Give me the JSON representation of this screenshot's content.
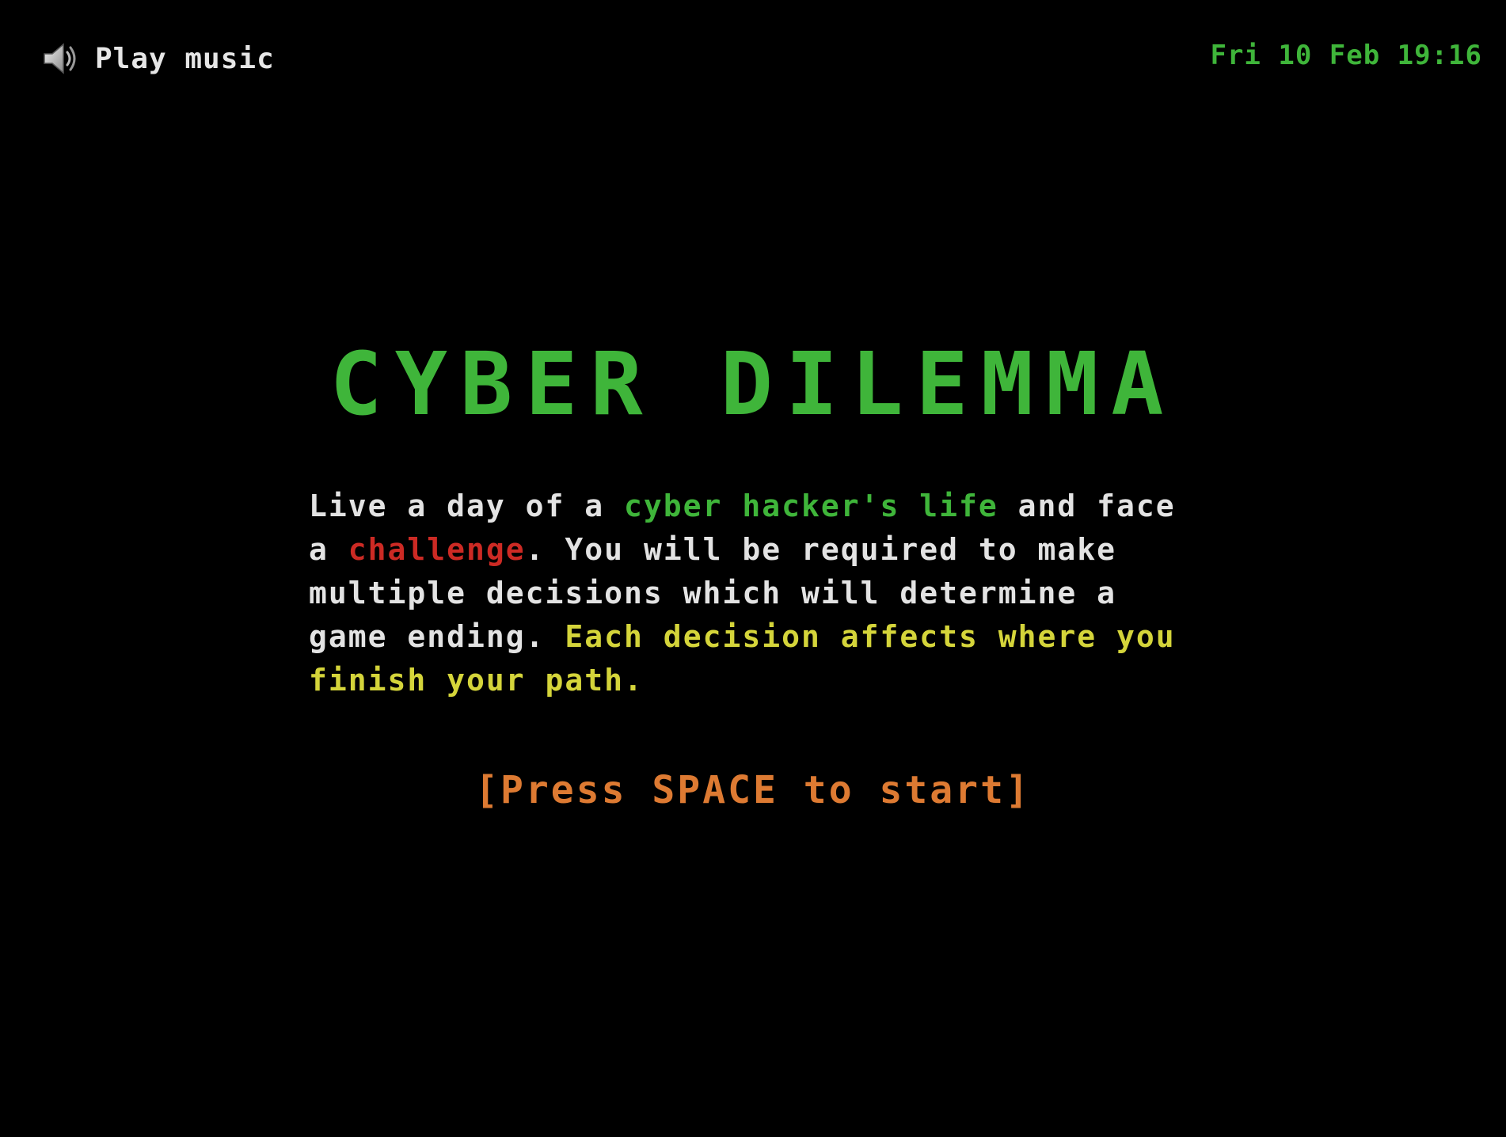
{
  "music": {
    "icon": "speaker-icon",
    "label": "Play music"
  },
  "clock": {
    "text": "Fri 10 Feb 19:16"
  },
  "title": "CYBER DILEMMA",
  "intro": {
    "part1": "Live a day of a ",
    "part2_highlight_green": "cyber hacker's life",
    "part3": " and face a ",
    "part4_highlight_red": "challenge",
    "part5": ". You will be required to make multiple decisions which will determine a game ending. ",
    "part6_highlight_yellow": "Each decision affects where you finish your path."
  },
  "prompt": "[Press SPACE to start]",
  "colors": {
    "background": "#000000",
    "green": "#3fb53a",
    "red": "#cc2a24",
    "yellow": "#d4d43a",
    "orange": "#dd7a32",
    "text": "#e3e3e3"
  }
}
